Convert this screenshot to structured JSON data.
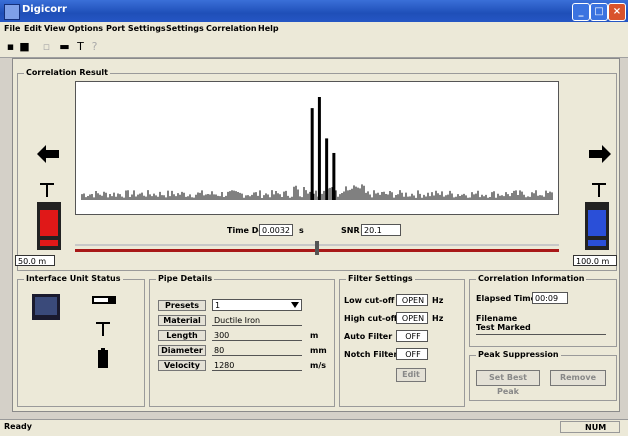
{
  "window": {
    "title": "Digicorr"
  },
  "menu": [
    "File",
    "Edit",
    "View",
    "Options",
    "Port Settings",
    "Settings",
    "Correlation",
    "Help"
  ],
  "toolbar": {
    "icons": [
      "disk-icon",
      "save-icon",
      "copy-icon",
      "print-icon",
      "antenna-icon",
      "help-icon"
    ]
  },
  "correlation": {
    "title": "Correlation Result",
    "time_delay_label": "Time Delay",
    "time_delay_value": "0.0032",
    "time_delay_unit": "s",
    "snr_label": "SNR",
    "snr_value": "20.1",
    "left_distance": "50.0 m",
    "right_distance": "100.0 m",
    "slider_position": 0.5
  },
  "chart_data": {
    "type": "bar",
    "description_peaks": [
      {
        "position": 0.49,
        "height": 0.82
      },
      {
        "position": 0.505,
        "height": 0.92
      },
      {
        "position": 0.52,
        "height": 0.55
      },
      {
        "position": 0.535,
        "height": 0.42
      }
    ]
  },
  "interface_unit": {
    "title": "Interface Unit Status"
  },
  "pipe": {
    "title": "Pipe Details",
    "rows": [
      {
        "label": "Presets",
        "value": "1",
        "unit": ""
      },
      {
        "label": "Material",
        "value": "Ductile Iron",
        "unit": ""
      },
      {
        "label": "Length",
        "value": "300",
        "unit": "m"
      },
      {
        "label": "Diameter",
        "value": "80",
        "unit": "mm"
      },
      {
        "label": "Velocity",
        "value": "1280",
        "unit": "m/s"
      }
    ]
  },
  "filter": {
    "title": "Filter Settings",
    "rows": [
      {
        "label": "Low cut-off",
        "value": "OPEN",
        "unit": "Hz"
      },
      {
        "label": "High cut-off",
        "value": "OPEN",
        "unit": "Hz"
      },
      {
        "label": "Auto Filter",
        "value": "OFF",
        "unit": ""
      },
      {
        "label": "Notch Filter",
        "value": "OFF",
        "unit": ""
      }
    ],
    "edit_label": "Edit"
  },
  "info": {
    "title": "Correlation Information",
    "elapsed_label": "Elapsed Time",
    "elapsed_value": "00:09",
    "filename_label": "Filename",
    "filename_value": "Test Marked"
  },
  "peak": {
    "title": "Peak Suppression",
    "btn1": "Set Best Peak",
    "btn2": "Remove"
  },
  "status": {
    "left": "Ready",
    "right": "NUM"
  },
  "colors": {
    "red_unit": "#e01818",
    "blue_unit": "#2a4fd8",
    "slider_track": "#a81818"
  }
}
